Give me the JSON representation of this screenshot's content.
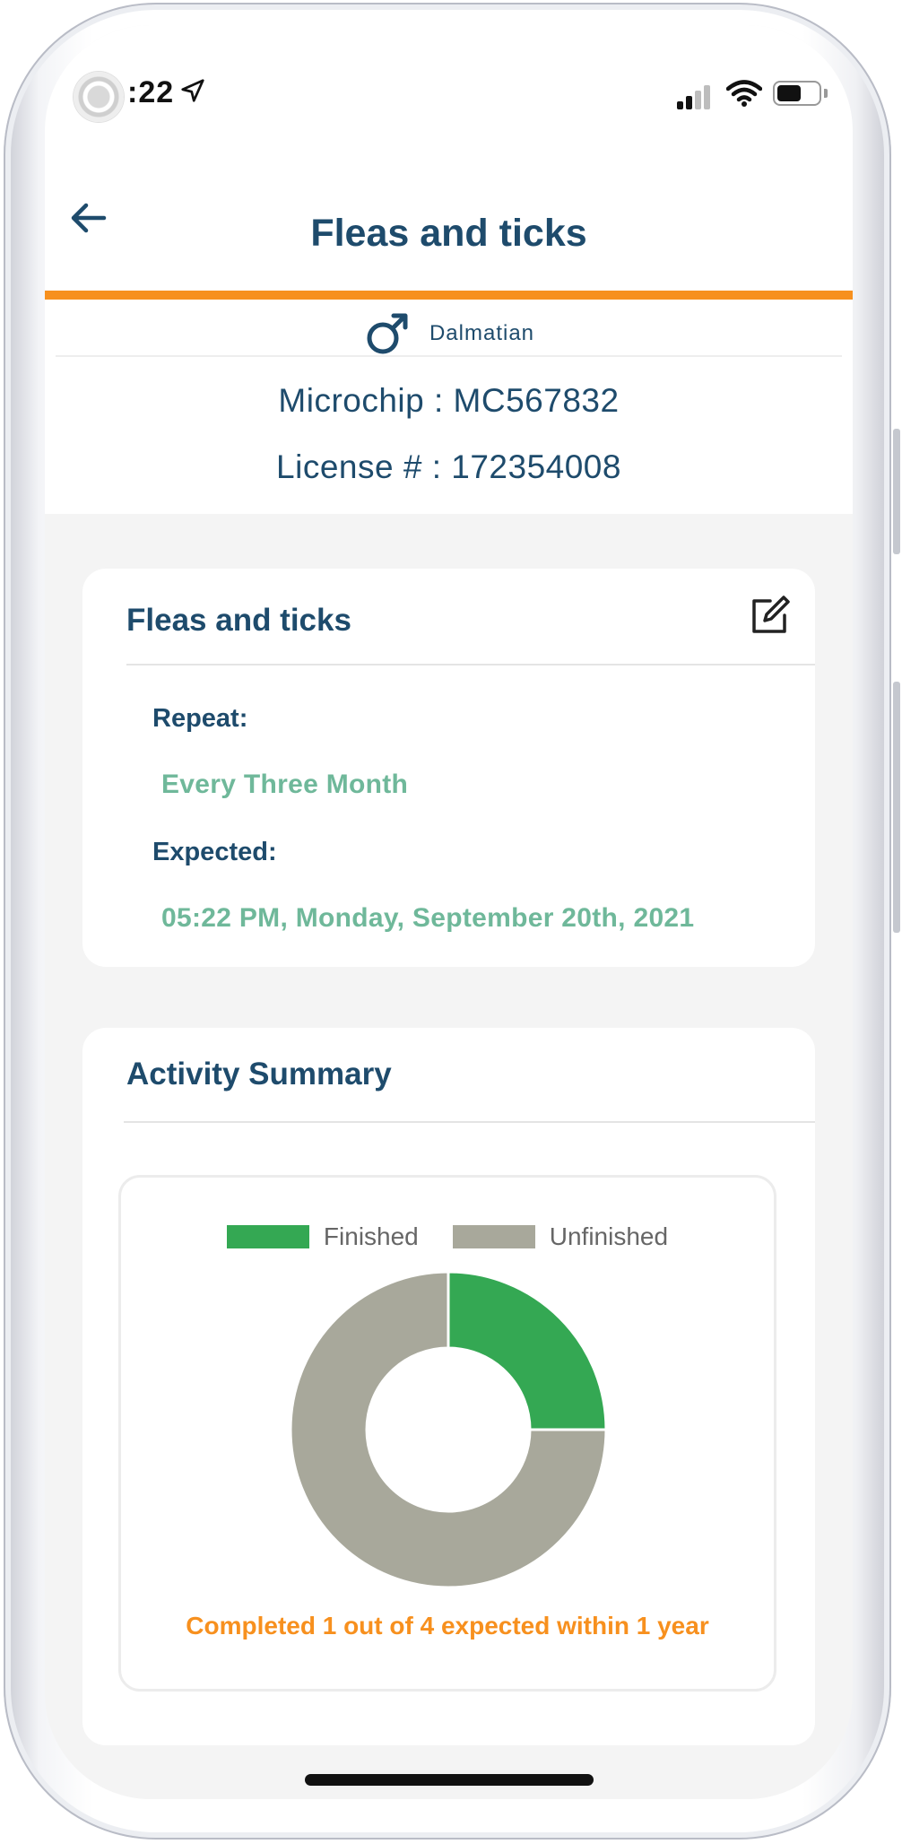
{
  "status_bar": {
    "time": ":22",
    "icons": [
      "location-arrow-icon",
      "cellular-signal-icon",
      "wifi-icon",
      "battery-icon"
    ]
  },
  "header": {
    "back_icon": "back-arrow-icon",
    "title": "Fleas and ticks"
  },
  "pet": {
    "gender_icon": "male-symbol-icon",
    "breed": "Dalmatian",
    "microchip": "Microchip : MC567832",
    "license": "License # : 172354008"
  },
  "reminder_card": {
    "title": "Fleas and ticks",
    "edit_icon": "edit-icon",
    "repeat_label": "Repeat:",
    "repeat_value": "Every Three Month",
    "expected_label": "Expected:",
    "expected_value": "05:22 PM, Monday, September 20th, 2021"
  },
  "summary_card": {
    "title": "Activity Summary",
    "caption": "Completed 1 out of 4 expected within 1 year"
  },
  "chart_data": {
    "type": "pie",
    "variant": "donut",
    "categories": [
      "Finished",
      "Unfinished"
    ],
    "values": [
      1,
      3
    ],
    "colors": [
      "#34a853",
      "#a8a89b"
    ],
    "legend_position": "top"
  },
  "colors": {
    "accent_orange": "#f7901e",
    "primary_navy": "#1e4b6c",
    "value_green": "#6fb89a"
  }
}
